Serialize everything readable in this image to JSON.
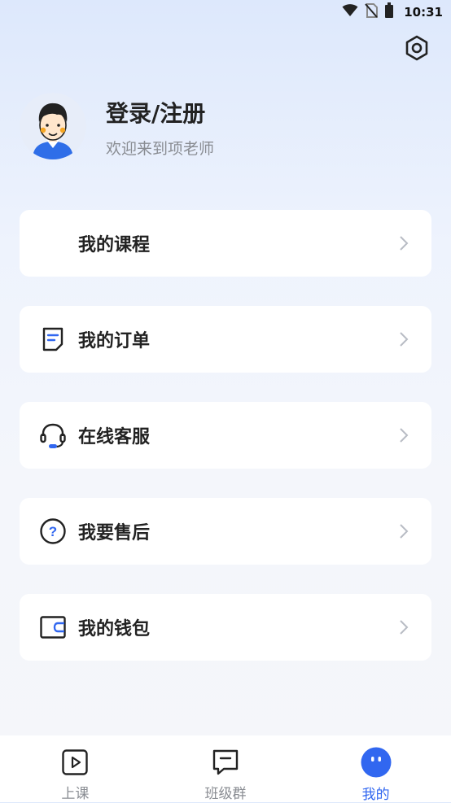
{
  "status_bar": {
    "time": "10:31"
  },
  "profile": {
    "title": "登录/注册",
    "subtitle": "欢迎来到项老师"
  },
  "menu": [
    {
      "label": "我的课程",
      "icon": "course-icon"
    },
    {
      "label": "我的订单",
      "icon": "order-icon"
    },
    {
      "label": "在线客服",
      "icon": "headset-icon"
    },
    {
      "label": "我要售后",
      "icon": "question-icon"
    },
    {
      "label": "我的钱包",
      "icon": "wallet-icon"
    }
  ],
  "tabbar": {
    "tabs": [
      {
        "label": "上课",
        "icon": "play-icon",
        "active": false
      },
      {
        "label": "班级群",
        "icon": "chat-icon",
        "active": false
      },
      {
        "label": "我的",
        "icon": "profile-face-icon",
        "active": true
      }
    ]
  },
  "colors": {
    "accent": "#3167f0",
    "text": "#222222",
    "muted": "#8a8d93",
    "card": "#ffffff"
  }
}
